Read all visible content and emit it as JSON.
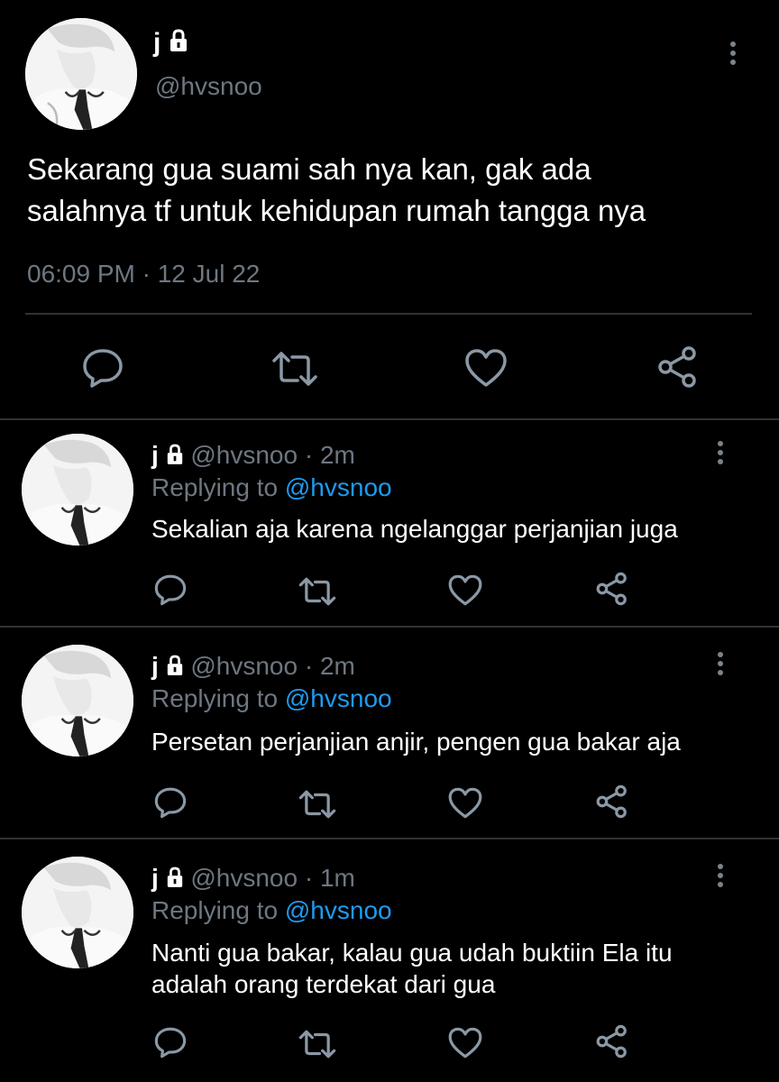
{
  "main_tweet": {
    "display_name": "j",
    "handle": "@hvsnoo",
    "text_line1": "Sekarang gua suami sah nya kan, gak ada",
    "text_line2": "salahnya tf untuk kehidupan rumah tangga nya",
    "timestamp": "06:09 PM · 12 Jul 22"
  },
  "replies": [
    {
      "display_name": "j",
      "handle_time": "@hvsnoo · 2m",
      "replying_label": "Replying to",
      "replying_handle": "@hvsnoo",
      "text_line1": "Sekalian aja karena ngelanggar perjanjian juga",
      "text_line2": ""
    },
    {
      "display_name": "j",
      "handle_time": "@hvsnoo · 2m",
      "replying_label": "Replying to",
      "replying_handle": "@hvsnoo",
      "text_line1": "Persetan perjanjian anjir, pengen gua bakar aja",
      "text_line2": ""
    },
    {
      "display_name": "j",
      "handle_time": "@hvsnoo · 1m",
      "replying_label": "Replying to",
      "replying_handle": "@hvsnoo",
      "text_line1": "Nanti gua bakar, kalau gua udah buktiin Ela itu",
      "text_line2": "adalah orang terdekat dari gua"
    }
  ],
  "icons": {
    "reply": "reply-icon",
    "retweet": "retweet-icon",
    "like": "heart-icon",
    "share": "share-icon",
    "lock": "lock-icon",
    "more": "more-vertical-icon"
  },
  "colors": {
    "background": "#000000",
    "muted": "#6e7781",
    "link": "#1d9bf0",
    "divider": "#2f3336"
  }
}
